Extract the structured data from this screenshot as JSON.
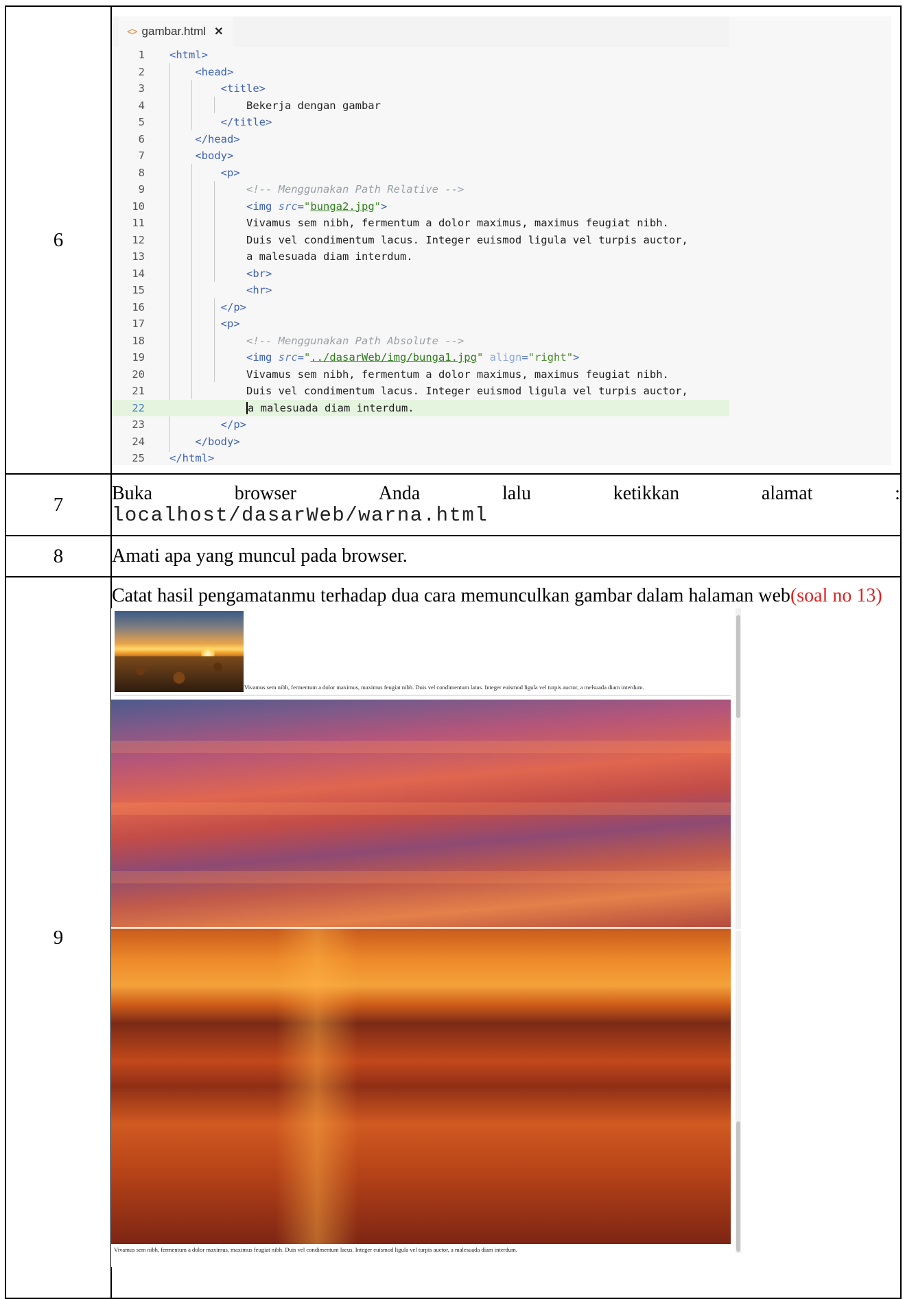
{
  "rows": [
    {
      "number": "6"
    },
    {
      "number": "7",
      "text_words": [
        "Buka",
        "browser",
        "Anda",
        "lalu",
        "ketikkan",
        "alamat",
        ":"
      ],
      "address": "localhost/dasarWeb/warna.html"
    },
    {
      "number": "8",
      "text": "Amati apa yang muncul pada browser."
    },
    {
      "number": "9",
      "text": "Catat hasil pengamatanmu terhadap dua cara memunculkan gambar dalam halaman web",
      "note": "(soal no 13)"
    }
  ],
  "editor": {
    "tab_title": "gambar.html",
    "tab_icon": "code-file-icon",
    "close_icon": "close-icon",
    "active_line": 22,
    "lines": [
      {
        "n": "1"
      },
      {
        "n": "2"
      },
      {
        "n": "3"
      },
      {
        "n": "4",
        "text": "Bekerja dengan gambar"
      },
      {
        "n": "5"
      },
      {
        "n": "6"
      },
      {
        "n": "7"
      },
      {
        "n": "8"
      },
      {
        "n": "9",
        "comment": "<!-- Menggunakan Path Relative -->"
      },
      {
        "n": "10",
        "src": "bunga2.jpg"
      },
      {
        "n": "11",
        "text": "Vivamus sem nibh, fermentum a dolor maximus, maximus feugiat nibh."
      },
      {
        "n": "12",
        "text": "Duis vel condimentum lacus. Integer euismod ligula vel turpis auctor,"
      },
      {
        "n": "13",
        "text": "a malesuada diam interdum."
      },
      {
        "n": "14"
      },
      {
        "n": "15"
      },
      {
        "n": "16"
      },
      {
        "n": "17"
      },
      {
        "n": "18",
        "comment": "<!-- Menggunakan Path Absolute -->"
      },
      {
        "n": "19",
        "src": "../dasarWeb/img/bunga1.jpg",
        "align": "right"
      },
      {
        "n": "20",
        "text": "Vivamus sem nibh, fermentum a dolor maximus, maximus feugiat nibh."
      },
      {
        "n": "21",
        "text": "Duis vel condimentum lacus. Integer euismod ligula vel turpis auctor,"
      },
      {
        "n": "22",
        "text": "a malesuada diam interdum."
      },
      {
        "n": "23"
      },
      {
        "n": "24"
      },
      {
        "n": "25"
      }
    ]
  },
  "browser_preview": {
    "caption_1": "Vivamus sem nibh, fermentum a dolor maximus, maximus feugiat nibh. Duis vel condimentum latus. Integer euismod ligula vel turpis auctor, a melsuada diam interdum.",
    "caption_2": "Vivamus sem nibh, fermentum a dolor maximus, maximus feugiat nibh. Duis vel condimentum lacus. Integer euismod ligula vel turpis auctor, a malesuada diam interdum."
  },
  "colors": {
    "note_red": "#e02020",
    "tag_blue": "#3d62b8",
    "string_green": "#4b8b2b",
    "comment_gray": "#9aa0a6",
    "active_line_bg": "#e5f4de"
  }
}
